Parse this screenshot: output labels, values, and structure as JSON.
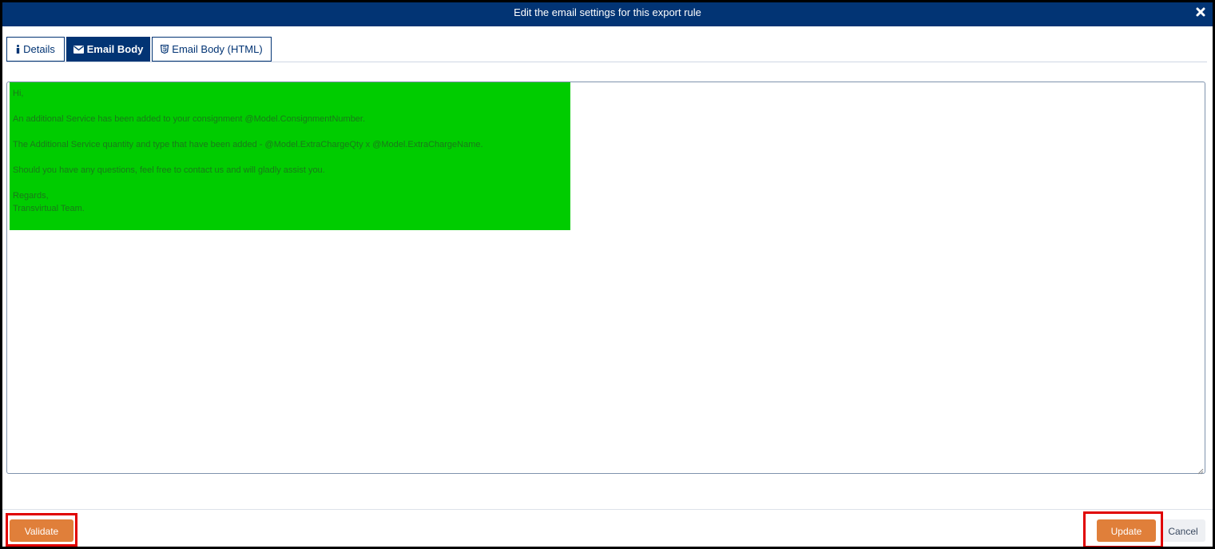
{
  "dialog": {
    "title": "Edit the email settings for this export rule",
    "close_icon": "close-icon"
  },
  "tabs": [
    {
      "label": "Details",
      "icon": "info-icon",
      "active": false
    },
    {
      "label": "Email Body",
      "icon": "envelope-icon",
      "active": true
    },
    {
      "label": "Email Body (HTML)",
      "icon": "html5-icon",
      "active": false
    }
  ],
  "editor": {
    "highlight_color": "#00cc00",
    "lines": [
      "Hi,",
      "An additional Service has been added to your consignment @Model.ConsignmentNumber.",
      "The Additional Service quantity and type that have been added - @Model.ExtraChargeQty x @Model.ExtraChargeName.",
      "Should you have any questions, feel free to contact us and will gladly assist you.",
      "Regards,",
      "Transvirtual Team."
    ]
  },
  "footer": {
    "validate_label": "Validate",
    "update_label": "Update",
    "cancel_label": "Cancel"
  },
  "colors": {
    "header": "#023474",
    "primary_button": "#e07f3a",
    "annotation": "#e00000"
  }
}
